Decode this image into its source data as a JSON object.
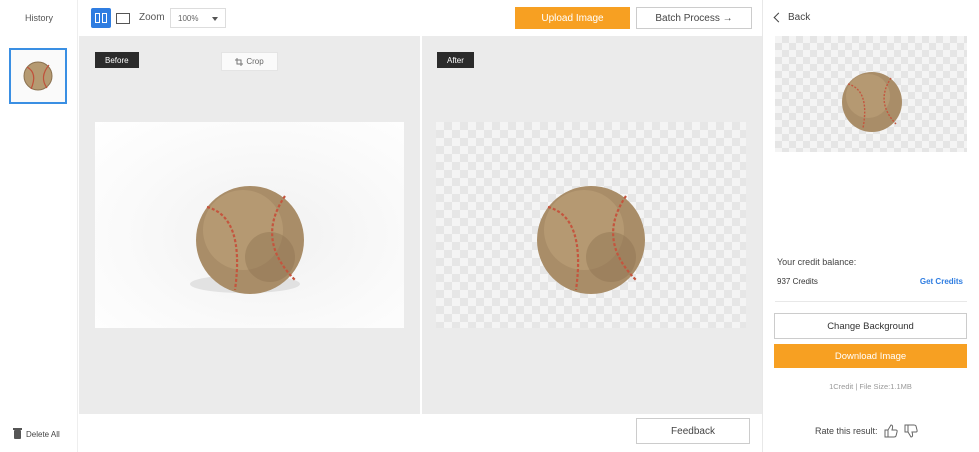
{
  "history": {
    "title": "History",
    "delete_all": "Delete All"
  },
  "toolbar": {
    "zoom_label": "Zoom",
    "zoom_value": "100%",
    "upload_label": "Upload Image",
    "batch_label": "Batch Process →"
  },
  "panels": {
    "before_label": "Before",
    "crop_label": "Crop",
    "after_label": "After"
  },
  "feedback_label": "Feedback",
  "sidebar": {
    "back_label": "Back",
    "credit_label": "Your credit balance:",
    "credit_value": "937 Credits",
    "get_credits": "Get Credits",
    "change_bg_label": "Change Background",
    "download_label": "Download Image",
    "file_info": "1Credit | File Size:1.1MB",
    "rate_label": "Rate this result:"
  },
  "colors": {
    "accent_orange": "#f7a022",
    "accent_blue": "#2f7de1",
    "panel_bg": "#ebebeb"
  },
  "icons": [
    "split-view-icon",
    "single-view-icon",
    "chevron-down-icon",
    "crop-icon",
    "chevron-left-icon",
    "thumbs-up-icon",
    "thumbs-down-icon",
    "trash-icon"
  ]
}
